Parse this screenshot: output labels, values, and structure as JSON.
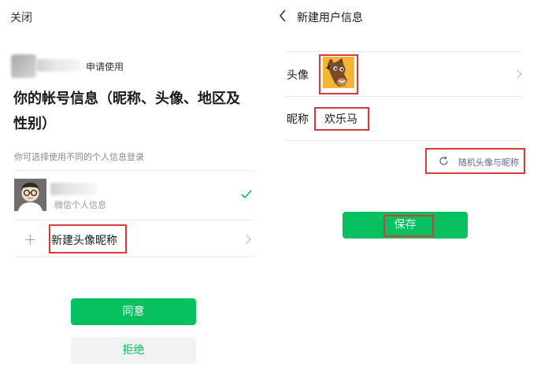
{
  "left": {
    "close_label": "关闭",
    "request_label": "申请使用",
    "title": "你的帐号信息（昵称、头像、地区及性别）",
    "subtitle": "你可选择使用不同的个人信息登录",
    "profile_caption": "微信个人信息",
    "new_option_label": "新建头像昵称",
    "plus_symbol": "+",
    "agree_label": "同意",
    "reject_label": "拒绝"
  },
  "right": {
    "page_title": "新建用户信息",
    "avatar_label": "头像",
    "nickname_label": "昵称",
    "nickname_value": "欢乐马",
    "random_label": "随机头像与昵称",
    "save_label": "保存"
  },
  "colors": {
    "accent_green": "#07c160",
    "highlight_red": "#d83a3a",
    "reject_bg": "#f2f2f2",
    "divider": "#e9e9e9"
  },
  "icons": [
    "back-chevron-icon",
    "checkmark-icon",
    "plus-icon",
    "chevron-right-icon",
    "refresh-icon"
  ]
}
